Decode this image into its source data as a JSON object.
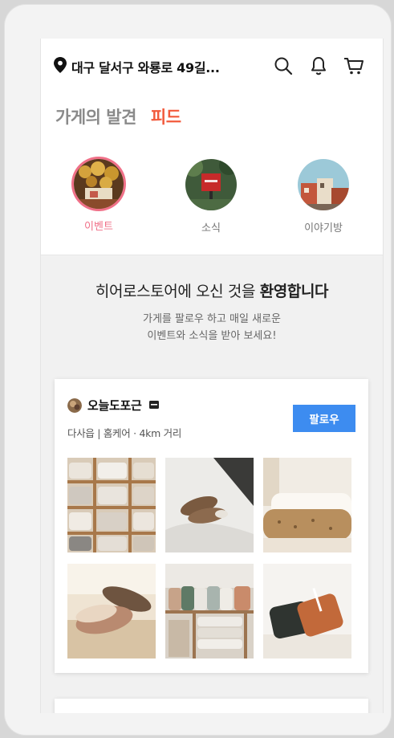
{
  "header": {
    "location": "대구 달서구 와룡로 49길...",
    "icons": [
      "location-pin-icon",
      "search-icon",
      "bell-icon",
      "cart-icon"
    ]
  },
  "tabs": {
    "store": "가게의 발견",
    "feed": "피드"
  },
  "categories": [
    {
      "label": "이벤트",
      "active": true
    },
    {
      "label": "소식",
      "active": false
    },
    {
      "label": "이야기방",
      "active": false
    }
  ],
  "welcome": {
    "title_prefix": "히어로스토어에 오신 것을 ",
    "title_bold": "환영합니다",
    "sub_line1": "가게를 팔로우 하고 매일 새로운",
    "sub_line2": "이벤트와 소식을 받아 보세요!"
  },
  "store_card": {
    "name": "오늘도포근",
    "meta": "다사읍 | 홈케어 · 4km 거리",
    "follow_label": "팔로우"
  },
  "colors": {
    "accent_red": "#f25a3c",
    "active_pink": "#f07088",
    "follow_blue": "#3d8cf0"
  }
}
